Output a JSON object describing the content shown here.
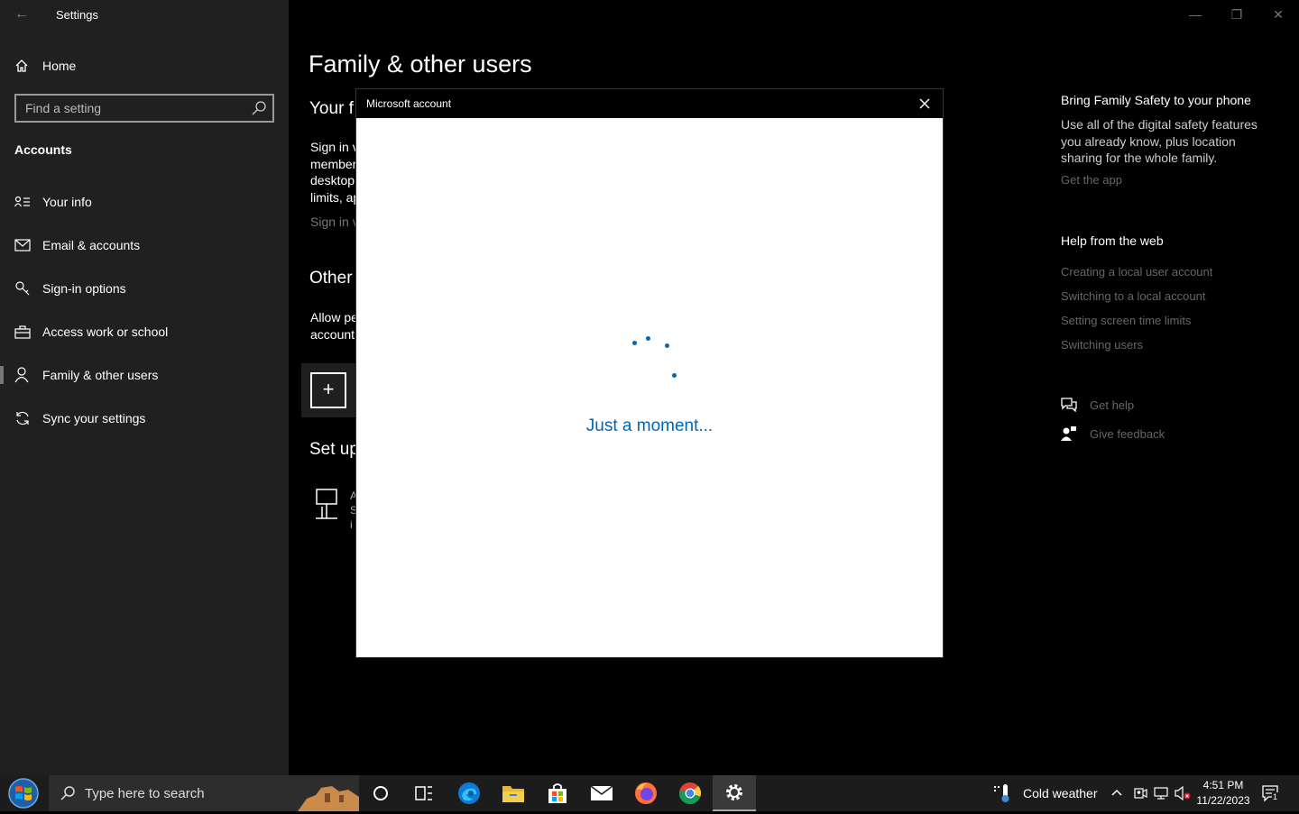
{
  "app": {
    "title": "Settings",
    "back_glyph": "←",
    "minimize_glyph": "—",
    "restore_glyph": "❐",
    "close_glyph": "✕"
  },
  "sidebar": {
    "home_label": "Home",
    "search_placeholder": "Find a setting",
    "section_label": "Accounts",
    "items": [
      {
        "label": "Your info",
        "icon": "person-card-icon"
      },
      {
        "label": "Email & accounts",
        "icon": "mail-icon"
      },
      {
        "label": "Sign-in options",
        "icon": "key-icon"
      },
      {
        "label": "Access work or school",
        "icon": "briefcase-icon"
      },
      {
        "label": "Family & other users",
        "icon": "person-icon",
        "active": true
      },
      {
        "label": "Sync your settings",
        "icon": "sync-icon"
      }
    ]
  },
  "main": {
    "title": "Family & other users",
    "your_family_head": "Your f",
    "your_family_lines": [
      "Sign in v",
      "member",
      "desktop",
      "limits, ap"
    ],
    "sign_in_link": "Sign in v",
    "other_head": "Other",
    "other_lines": [
      "Allow pe",
      "account"
    ],
    "add_glyph": "+",
    "setup_head": "Set up",
    "kiosk_lines": [
      "A",
      "S",
      "i"
    ]
  },
  "right_panel": {
    "family_safety_head": "Bring Family Safety to your phone",
    "family_safety_lines": [
      "Use all of the digital safety features",
      "you already know, plus location",
      "sharing for the whole family."
    ],
    "get_app_link": "Get the app",
    "help_head": "Help from the web",
    "help_links": [
      "Creating a local user account",
      "Switching to a local account",
      "Setting screen time limits",
      "Switching users"
    ],
    "get_help": "Get help",
    "give_feedback": "Give feedback"
  },
  "dialog": {
    "title": "Microsoft account",
    "loading_text": "Just a moment...",
    "accent_color": "#0067b8"
  },
  "taskbar": {
    "search_placeholder": "Type here to search",
    "weather": "Cold weather",
    "time": "4:51 PM",
    "date": "11/22/2023",
    "notification_count": "1",
    "apps": [
      "cortana-icon",
      "task-view-icon",
      "edge-icon",
      "file-explorer-icon",
      "store-icon",
      "mail-icon",
      "firefox-icon",
      "chrome-icon",
      "settings-icon"
    ]
  }
}
